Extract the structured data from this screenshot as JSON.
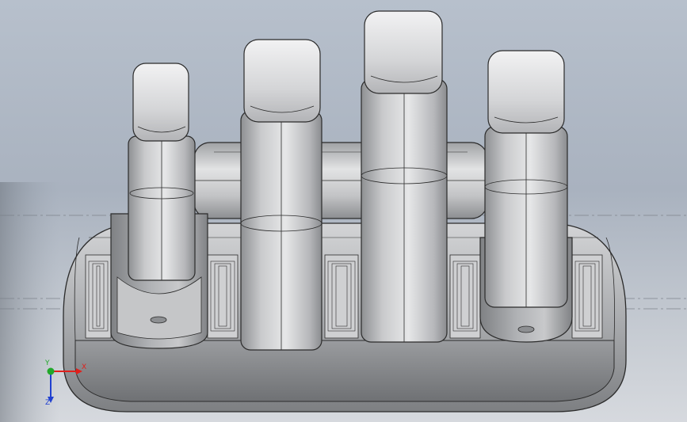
{
  "view": {
    "colors": {
      "background_top": "#b7c0cc",
      "background_bottom": "#d6d9de",
      "model_light": "#d9dadb",
      "model_mid": "#b9babc",
      "model_dark": "#7f8184",
      "edge": "#2b2b2b"
    }
  },
  "triad": {
    "x_label": "X",
    "y_label": "Y",
    "z_label": "Z",
    "x_color": "#e0201c",
    "y_color": "#22a82a",
    "z_color": "#2040d0"
  }
}
